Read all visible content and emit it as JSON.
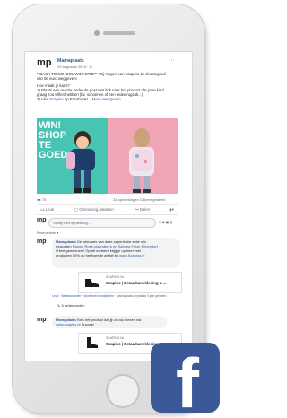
{
  "post": {
    "page_name": "Mamaplaats",
    "date": "29 augustus 2016 · ",
    "logo": "mp",
    "line1": "**BACK TO SCHOOL WINACTIE!** Wij mogen van Scapino 2x shoptegoed",
    "line2": "van 50 euro weggeven!",
    "line3": "Hoe maak je kans?",
    "line4": "1) Plaats een reactie onder de post met link naar het product dat jouw kind",
    "line5": "graag zou willen hebben (bv. schoenen of een leuke rugzak...)",
    "line6": "2) Like ",
    "line6_link": "Scapino",
    "line6_rest": " op Facebook!... ",
    "more": "Meer weergeven",
    "banner_text": [
      "WIN!",
      "SHOP",
      "TE",
      "GOED"
    ],
    "reactions_count": "75",
    "stats": "31 opmerkingen  13 keer gedeeld"
  },
  "actions": {
    "like": "Leuk",
    "comment": "Opmerking plaatsen",
    "share": "Delen"
  },
  "composer": {
    "placeholder": "Schrijf een opmerking..."
  },
  "sort": {
    "label": "Relevantste ▾"
  },
  "comment1": {
    "author": "Mamaplaats",
    "text1": " De winnaars van deze superleuke actie zijn",
    "text2": "geworden ",
    "names": "Rianne Rosé-vlaanderen en Sabrina Fritze Elmendorf",
    "text3": "! Heel gewonnen? Op dit moment krijg je op heel veel",
    "text4": "producten 50% op het tweede artikel bij ",
    "link": "www.Scapino.nl",
    "preview_domain": "SCAPINO.NL",
    "preview_title": "Scapino | Betaalbare kleding & ...",
    "meta": "Leuk · Beantwoorden · Voorbeeld verwijderen · ",
    "meta_time": "Mamaplaats geplaatst 4 jaar geleden",
    "replies": "↳ 3 antwoorden"
  },
  "comment2": {
    "author": "Mamaplaats",
    "text1": " Kies het product dat jij uit zou kiezen via",
    "link": "www.scapino.nl",
    "text2": " Succes!",
    "preview_domain": "SCAPINO.NL",
    "preview_title": "Scapino | Betaalbare kleding & ..."
  },
  "brand_colors": {
    "facebook_blue": "#3b5998",
    "link_blue": "#365899"
  },
  "icon_names": [
    "facebook-logo-icon",
    "like-icon",
    "comment-icon",
    "share-icon",
    "camera-icon",
    "emoji-icon",
    "gif-icon"
  ]
}
